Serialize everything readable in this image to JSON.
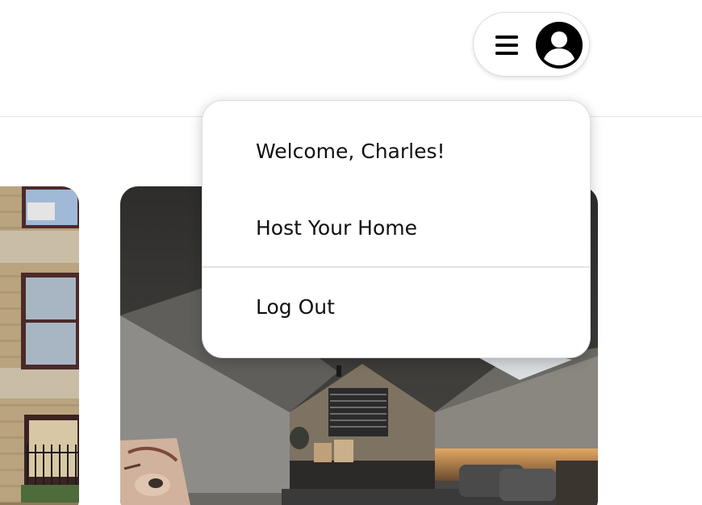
{
  "header": {
    "menu_icon": "hamburger-menu-icon",
    "avatar_icon": "user-avatar-icon"
  },
  "dropdown": {
    "welcome_text": "Welcome, Charles!",
    "host_label": "Host Your Home",
    "logout_label": "Log Out"
  },
  "listings": [
    {
      "image": "brick-building-facade"
    },
    {
      "image": "attic-bedroom-interior"
    }
  ],
  "colors": {
    "text": "#111111",
    "border": "#dddddd",
    "divider": "#e2e2e2"
  }
}
